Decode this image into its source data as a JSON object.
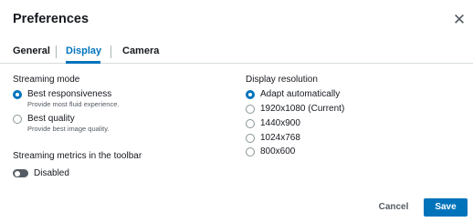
{
  "dialog": {
    "title": "Preferences",
    "close_icon": "close-icon"
  },
  "tabs": [
    {
      "label": "General",
      "active": false
    },
    {
      "label": "Display",
      "active": true
    },
    {
      "label": "Camera",
      "active": false
    }
  ],
  "streaming_mode": {
    "label": "Streaming mode",
    "options": [
      {
        "label": "Best responsiveness",
        "description": "Provide most fluid experience.",
        "checked": true
      },
      {
        "label": "Best quality",
        "description": "Provide best image quality.",
        "checked": false
      }
    ]
  },
  "streaming_metrics": {
    "label": "Streaming metrics in the toolbar",
    "toggle_label": "Disabled",
    "enabled": false
  },
  "display_resolution": {
    "label": "Display resolution",
    "options": [
      {
        "label": "Adapt automatically",
        "checked": true
      },
      {
        "label": "1920x1080 (Current)",
        "checked": false
      },
      {
        "label": "1440x900",
        "checked": false
      },
      {
        "label": "1024x768",
        "checked": false
      },
      {
        "label": "800x600",
        "checked": false
      }
    ]
  },
  "footer": {
    "cancel_label": "Cancel",
    "save_label": "Save"
  },
  "colors": {
    "accent": "#0073bb",
    "text": "#16191f",
    "muted": "#545b64"
  }
}
